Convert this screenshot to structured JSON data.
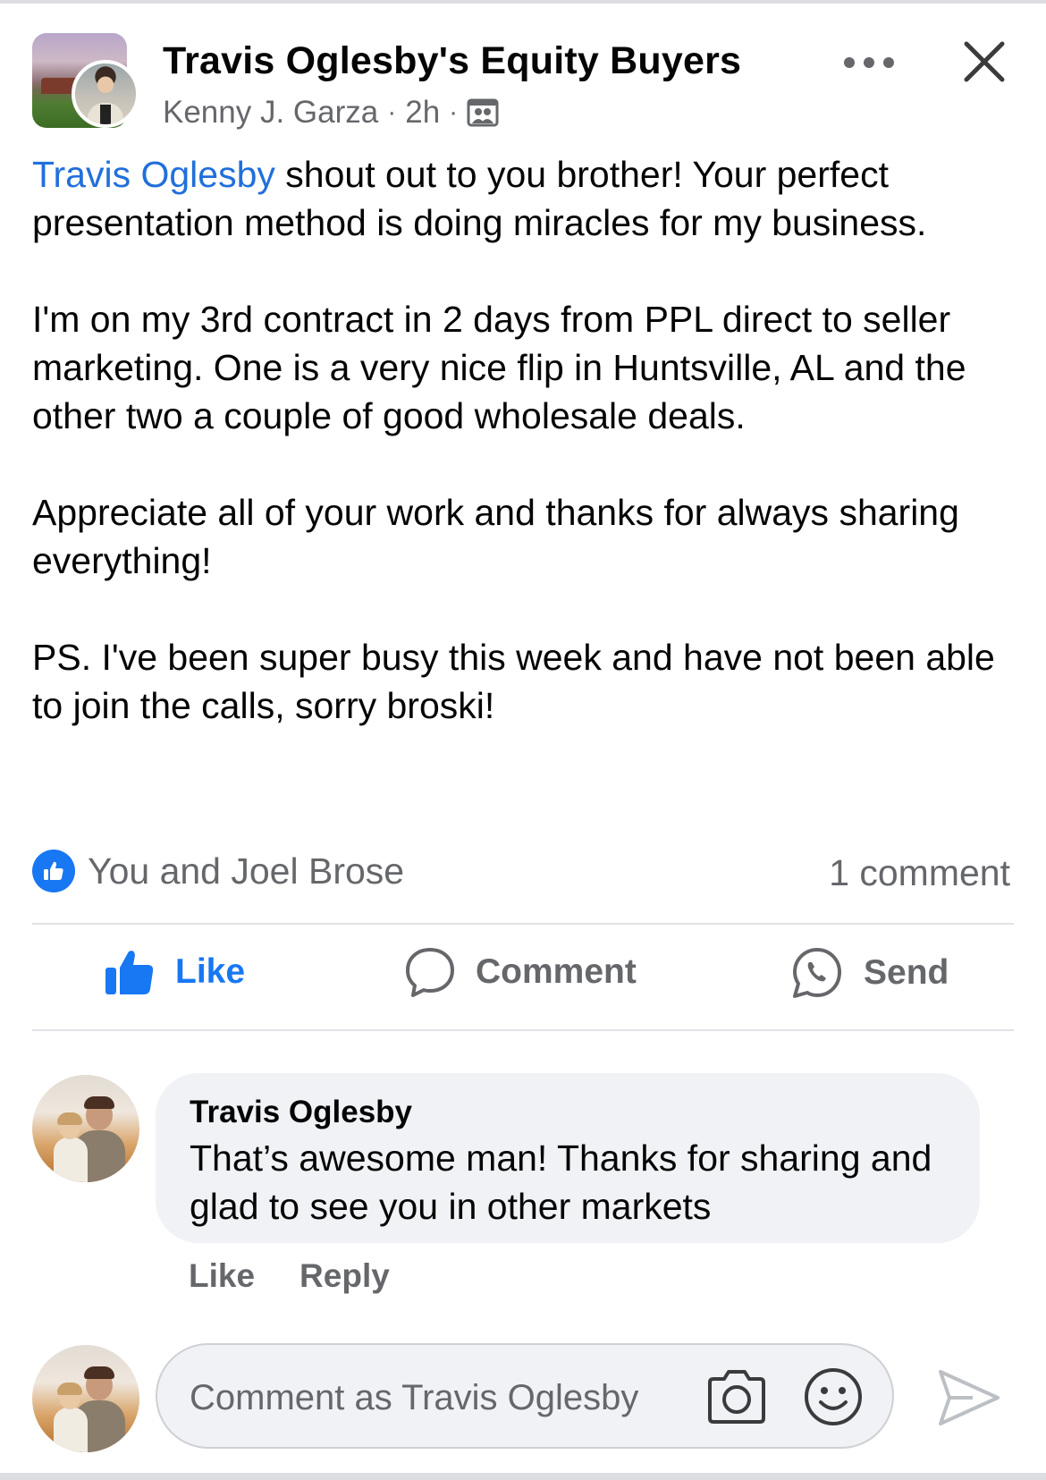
{
  "header": {
    "group_name": "Travis Oglesby's Equity Buyers",
    "author": "Kenny J. Garza",
    "separator": "·",
    "time": "2h",
    "audience_icon": "group-members-icon",
    "more_icon": "more-horizontal-icon",
    "close_icon": "close-icon"
  },
  "post": {
    "mention": "Travis Oglesby",
    "paragraph1_rest": " shout out to you brother! Your perfect presentation method is doing miracles for my business.",
    "paragraph2": "I'm on my 3rd contract in 2 days from PPL direct to seller marketing. One is a very nice flip in Huntsville, AL and the other two a couple of good wholesale deals.",
    "paragraph3": "Appreciate all of your work and thanks for always sharing everything!",
    "paragraph4": "PS. I've been super busy this week and have not been able to join the calls, sorry broski!"
  },
  "reactions": {
    "text": "You and Joel Brose",
    "comments": "1 comment",
    "icon": "like-reaction-icon"
  },
  "actions": {
    "like": "Like",
    "comment": "Comment",
    "send": "Send"
  },
  "comment": {
    "author": "Travis Oglesby",
    "text": "That’s awesome man!  Thanks for sharing and glad to see you in other markets",
    "like": "Like",
    "reply": "Reply"
  },
  "composer": {
    "placeholder": "Comment as Travis Oglesby",
    "camera_icon": "camera-icon",
    "emoji_icon": "emoji-icon",
    "send_icon": "send-arrow-icon"
  },
  "colors": {
    "accent": "#1877f2",
    "mention": "#216fdb",
    "secondary_text": "#65676b",
    "bubble": "#f0f2f5"
  }
}
